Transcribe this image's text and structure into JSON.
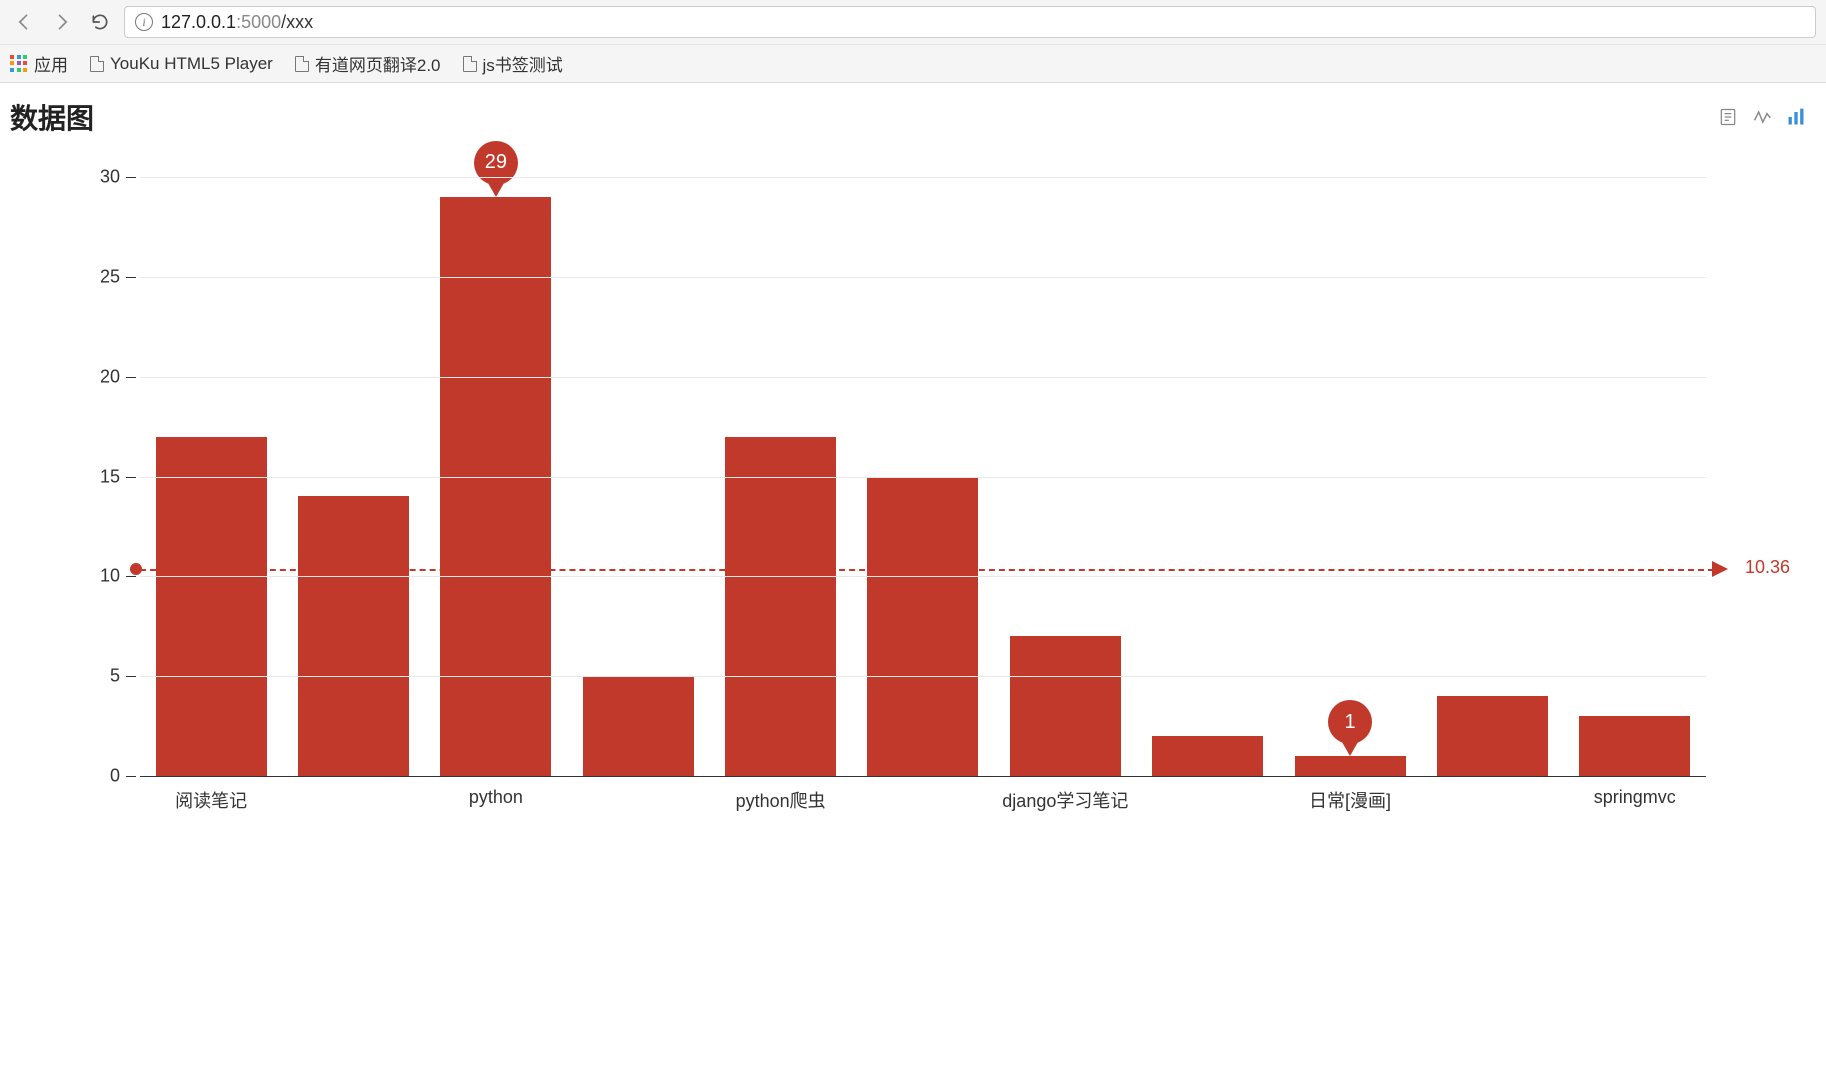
{
  "browser": {
    "url_host": "127.0.0.1",
    "url_port": ":5000",
    "url_path": "/xxx",
    "apps_label": "应用",
    "bookmarks": [
      "YouKu HTML5 Player",
      "有道网页翻译2.0",
      "js书签测试"
    ]
  },
  "chart": {
    "title": "数据图"
  },
  "chart_data": {
    "type": "bar",
    "categories": [
      "阅读笔记",
      "",
      "python",
      "",
      "python爬虫",
      "",
      "django学习笔记",
      "",
      "日常[漫画]",
      "",
      "springmvc"
    ],
    "display_categories": [
      "阅读笔记",
      "python",
      "python爬虫",
      "django学习笔记",
      "日常[漫画]",
      "springmvc"
    ],
    "values": [
      17,
      14,
      29,
      5,
      17,
      15,
      7,
      2,
      1,
      4,
      3
    ],
    "max_marker": {
      "index": 2,
      "value": 29
    },
    "min_marker": {
      "index": 8,
      "value": 1
    },
    "avg_line": 10.36,
    "avg_label": "10.36",
    "y_ticks": [
      0,
      5,
      10,
      15,
      20,
      25,
      30
    ],
    "ylim": [
      0,
      30
    ],
    "bar_color": "#c0392b"
  }
}
